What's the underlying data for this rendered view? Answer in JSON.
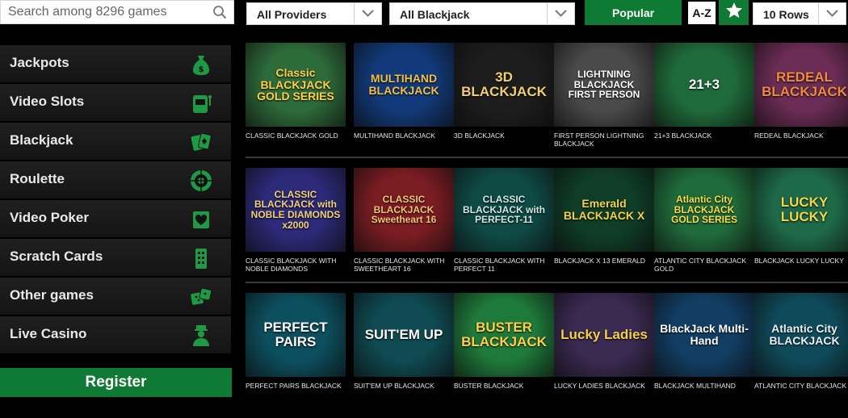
{
  "search": {
    "placeholder": "Search among 8296 games"
  },
  "filters": {
    "providers_value": "All Providers",
    "category_value": "All Blackjack",
    "rows_value": "10 Rows"
  },
  "sort": {
    "popular_label": "Popular",
    "az_label": "A-Z"
  },
  "colors": {
    "brand_green": "#0f7a33",
    "icon_green": "#1e9a45"
  },
  "sidebar": {
    "items": [
      {
        "label": "Jackpots",
        "icon": "money-bag-icon"
      },
      {
        "label": "Video Slots",
        "icon": "slot-machine-icon"
      },
      {
        "label": "Blackjack",
        "icon": "playing-cards-icon"
      },
      {
        "label": "Roulette",
        "icon": "roulette-wheel-icon"
      },
      {
        "label": "Video Poker",
        "icon": "poker-card-icon"
      },
      {
        "label": "Scratch Cards",
        "icon": "scratch-card-icon"
      },
      {
        "label": "Other games",
        "icon": "dice-icon"
      },
      {
        "label": "Live Casino",
        "icon": "dealer-icon"
      }
    ],
    "register_label": "Register"
  },
  "games": [
    [
      {
        "caption": "CLASSIC BLACKJACK GOLD",
        "art": "Classic BLACKJACK GOLD SERIES",
        "bg": "#2e6b3a",
        "fg": "#ffd24a"
      },
      {
        "caption": "MULTIHAND BLACKJACK",
        "art": "MULTIHAND BLACKJACK",
        "bg": "#123a7a",
        "fg": "#f2c14a"
      },
      {
        "caption": "3D BLACKJACK",
        "art": "3D BLACKJACK",
        "bg": "#1d1d1d",
        "fg": "#f0d070"
      },
      {
        "caption": "FIRST PERSON LIGHTNING BLACKJACK",
        "art": "LIGHTNING BLACKJACK FIRST PERSON",
        "bg": "#4a4a4a",
        "fg": "#ffffff"
      },
      {
        "caption": "21+3 BLACKJACK",
        "art": "21+3",
        "bg": "#1f6a3a",
        "fg": "#ffffff"
      },
      {
        "caption": "REDEAL BLACKJACK",
        "art": "REDEAL BLACKJACK",
        "bg": "#6b2c55",
        "fg": "#f08a3c"
      }
    ],
    [
      {
        "caption": "CLASSIC BLACKJACK WITH NOBLE DIAMONDS",
        "art": "CLASSIC BLACKJACK with NOBLE DIAMONDS x2000",
        "bg": "#2d2a7a",
        "fg": "#f2d37a"
      },
      {
        "caption": "CLASSIC BLACKJACK WITH SWEETHEART 16",
        "art": "CLASSIC BLACKJACK Sweetheart 16",
        "bg": "#7a1d22",
        "fg": "#f4c27a"
      },
      {
        "caption": "CLASSIC BLACKJACK WITH PERFECT 11",
        "art": "CLASSIC BLACKJACK with PERFECT-11",
        "bg": "#0f4a45",
        "fg": "#cfe9e4"
      },
      {
        "caption": "BLACKJACK X 13 EMERALD",
        "art": "Emerald BLACKJACK X",
        "bg": "#0f3d28",
        "fg": "#f2d24a"
      },
      {
        "caption": "ATLANTIC CITY BLACKJACK GOLD",
        "art": "Atlantic City BLACKJACK GOLD SERIES",
        "bg": "#1f6a3a",
        "fg": "#f7df4a"
      },
      {
        "caption": "BLACKJACK LUCKY LUCKY",
        "art": "LUCKY LUCKY",
        "bg": "#1e6a48",
        "fg": "#f4d84a"
      }
    ],
    [
      {
        "caption": "PERFECT PAIRS BLACKJACK",
        "art": "PERFECT PAIRS",
        "bg": "#0c4f5e",
        "fg": "#ffffff"
      },
      {
        "caption": "SUIT'EM UP BLACKJACK",
        "art": "SUIT'EM UP",
        "bg": "#0f4a52",
        "fg": "#ffffff"
      },
      {
        "caption": "BUSTER BLACKJACK",
        "art": "BUSTER BLACKJACK",
        "bg": "#1e7a3a",
        "fg": "#ffd04a"
      },
      {
        "caption": "LUCKY LADIES BLACKJACK",
        "art": "Lucky Ladies",
        "bg": "#3b2a52",
        "fg": "#f2d24a"
      },
      {
        "caption": "BLACKJACK MULTIHAND",
        "art": "BlackJack Multi-Hand",
        "bg": "#123e63",
        "fg": "#ffffff"
      },
      {
        "caption": "ATLANTIC CITY BLACKJACK",
        "art": "Atlantic City BLACKJACK",
        "bg": "#0f4a5a",
        "fg": "#e8f2f8"
      }
    ]
  ]
}
